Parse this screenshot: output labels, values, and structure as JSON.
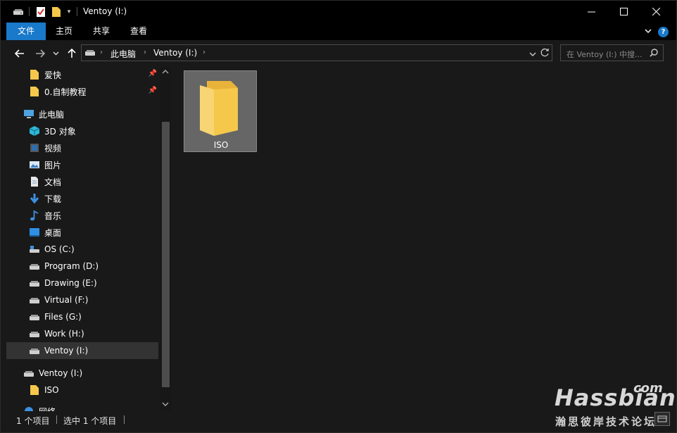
{
  "window": {
    "title": "Ventoy (I:)",
    "controls": {
      "minimize": "─",
      "maximize": "□",
      "close": "✕"
    }
  },
  "ribbon": {
    "tabs": [
      "文件",
      "主页",
      "共享",
      "查看"
    ],
    "help": "?"
  },
  "nav": {
    "back": "←",
    "forward": "→",
    "recent": "˅",
    "up": "↑",
    "breadcrumb": [
      "此电脑",
      "Ventoy (I:)"
    ],
    "search_placeholder": "在 Ventoy (I:) 中搜..."
  },
  "sidebar": {
    "items": [
      {
        "label": "爱快",
        "icon": "folder-icon",
        "pinned": true
      },
      {
        "label": "0.自制教程",
        "icon": "folder-icon",
        "pinned": true
      },
      {
        "label": "此电脑",
        "icon": "computer-icon"
      },
      {
        "label": "3D 对象",
        "icon": "cube-icon"
      },
      {
        "label": "视频",
        "icon": "video-icon"
      },
      {
        "label": "图片",
        "icon": "picture-icon"
      },
      {
        "label": "文档",
        "icon": "document-icon"
      },
      {
        "label": "下载",
        "icon": "download-icon"
      },
      {
        "label": "音乐",
        "icon": "music-icon"
      },
      {
        "label": "桌面",
        "icon": "desktop-icon"
      },
      {
        "label": "OS (C:)",
        "icon": "os-drive-icon"
      },
      {
        "label": "Program (D:)",
        "icon": "drive-icon"
      },
      {
        "label": "Drawing (E:)",
        "icon": "drive-icon"
      },
      {
        "label": "Virtual (F:)",
        "icon": "drive-icon"
      },
      {
        "label": "Files (G:)",
        "icon": "drive-icon"
      },
      {
        "label": "Work (H:)",
        "icon": "drive-icon"
      },
      {
        "label": "Ventoy (I:)",
        "icon": "drive-icon",
        "selected": true
      },
      {
        "label": "Ventoy (I:)",
        "icon": "drive-icon"
      },
      {
        "label": "ISO",
        "icon": "folder-icon"
      },
      {
        "label": "网络",
        "icon": "network-icon"
      }
    ]
  },
  "content": {
    "items": [
      {
        "name": "ISO",
        "type": "folder"
      }
    ]
  },
  "status": {
    "count": "1 个项目",
    "selected": "选中 1 个项目"
  },
  "watermark": {
    "brand": "Hassbian",
    "tld": "com",
    "subtitle": "瀚思彼岸技术论坛"
  },
  "colors": {
    "accent": "#1979ca",
    "folder": "#f5c84c",
    "background": "#191919"
  }
}
